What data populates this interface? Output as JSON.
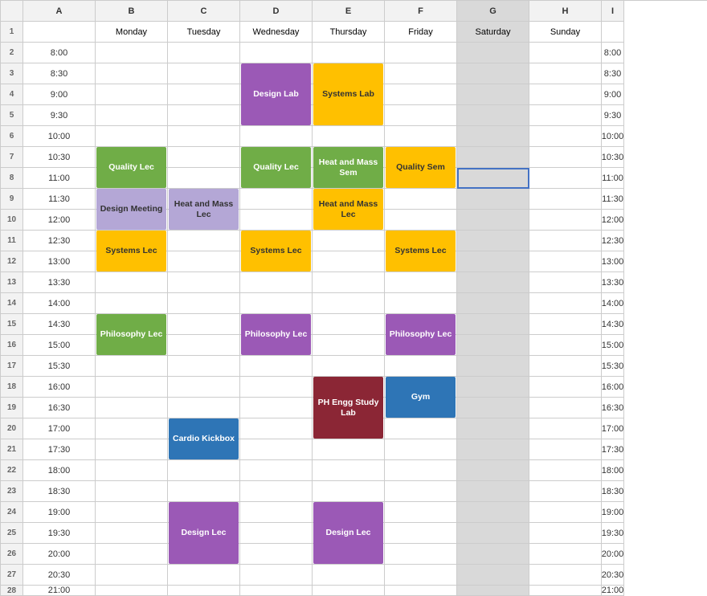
{
  "columns": {
    "headers": [
      "",
      "A",
      "B",
      "C",
      "D",
      "E",
      "F",
      "G",
      "H",
      "I"
    ],
    "day_headers": [
      "",
      "Monday",
      "Tuesday",
      "Wednesday",
      "Thursday",
      "Friday",
      "Saturday",
      "Sunday",
      ""
    ]
  },
  "rows": {
    "numbers": [
      "1",
      "2",
      "3",
      "4",
      "5",
      "6",
      "7",
      "8",
      "9",
      "10",
      "11",
      "12",
      "13",
      "14",
      "15",
      "16",
      "17",
      "18",
      "19",
      "20",
      "21",
      "22",
      "23",
      "24",
      "25",
      "26",
      "27",
      "28"
    ],
    "times": [
      "",
      "8:00",
      "8:30",
      "9:00",
      "9:30",
      "10:00",
      "10:30",
      "11:00",
      "11:30",
      "12:00",
      "12:30",
      "13:00",
      "13:30",
      "14:00",
      "14:30",
      "15:00",
      "15:30",
      "16:00",
      "16:30",
      "17:00",
      "17:30",
      "18:00",
      "18:30",
      "19:00",
      "19:30",
      "20:00",
      "20:30",
      "21:00"
    ]
  },
  "events": [
    {
      "id": "quality-lec-mon",
      "label": "Quality Lec",
      "color": "event-green",
      "col": 2,
      "row_start": 7,
      "row_span": 2
    },
    {
      "id": "design-meeting-mon",
      "label": "Design Meeting",
      "color": "event-lavender",
      "col": 2,
      "row_start": 9,
      "row_span": 2
    },
    {
      "id": "systems-lec-mon",
      "label": "Systems Lec",
      "color": "event-yellow",
      "col": 2,
      "row_start": 11,
      "row_span": 2
    },
    {
      "id": "philosophy-lec-mon",
      "label": "Philosophy Lec",
      "color": "event-green",
      "col": 2,
      "row_start": 15,
      "row_span": 2
    },
    {
      "id": "heat-mass-lec-tue",
      "label": "Heat and Mass Lec",
      "color": "event-lavender",
      "col": 3,
      "row_start": 10,
      "row_span": 2
    },
    {
      "id": "cardio-kickbox-tue",
      "label": "Cardio Kickbox",
      "color": "event-blue",
      "col": 3,
      "row_start": 20,
      "row_span": 2
    },
    {
      "id": "design-lec-tue",
      "label": "Design Lec",
      "color": "event-light-purple",
      "col": 3,
      "row_start": 24,
      "row_span": 3
    },
    {
      "id": "design-lab-wed",
      "label": "Design Lab",
      "color": "event-light-purple",
      "col": 4,
      "row_start": 3,
      "row_span": 3
    },
    {
      "id": "quality-lec-wed",
      "label": "Quality Lec",
      "color": "event-green",
      "col": 4,
      "row_start": 7,
      "row_span": 2
    },
    {
      "id": "systems-lec-wed",
      "label": "Systems Lec",
      "color": "event-yellow",
      "col": 4,
      "row_start": 11,
      "row_span": 2
    },
    {
      "id": "philosophy-lec-wed",
      "label": "Philosophy Lec",
      "color": "event-light-purple",
      "col": 4,
      "row_start": 15,
      "row_span": 2
    },
    {
      "id": "systems-lab-thu",
      "label": "Systems Lab",
      "color": "event-yellow",
      "col": 5,
      "row_start": 3,
      "row_span": 3
    },
    {
      "id": "heat-mass-sem-thu",
      "label": "Heat and Mass Sem",
      "color": "event-green",
      "col": 5,
      "row_start": 7,
      "row_span": 2
    },
    {
      "id": "heat-mass-lec-thu",
      "label": "Heat and Mass Lec",
      "color": "event-yellow",
      "col": 5,
      "row_start": 9,
      "row_span": 2
    },
    {
      "id": "ph-engg-thu",
      "label": "PH Engg Study Lab",
      "color": "event-dark-red",
      "col": 5,
      "row_start": 18,
      "row_span": 3
    },
    {
      "id": "design-lec-thu",
      "label": "Design Lec",
      "color": "event-light-purple",
      "col": 5,
      "row_start": 24,
      "row_span": 3
    },
    {
      "id": "quality-sem-fri",
      "label": "Quality Sem",
      "color": "event-yellow",
      "col": 6,
      "row_start": 7,
      "row_span": 2
    },
    {
      "id": "systems-lec-fri",
      "label": "Systems Lec",
      "color": "event-yellow",
      "col": 6,
      "row_start": 11,
      "row_span": 2
    },
    {
      "id": "philosophy-lec-fri",
      "label": "Philosophy Lec",
      "color": "event-light-purple",
      "col": 6,
      "row_start": 15,
      "row_span": 2
    },
    {
      "id": "gym-fri",
      "label": "Gym",
      "color": "event-blue",
      "col": 6,
      "row_start": 18,
      "row_span": 2
    },
    {
      "id": "selected-g8",
      "label": "",
      "color": "selected-cell",
      "col": 7,
      "row_start": 8,
      "row_span": 1
    }
  ],
  "colors": {
    "header_bg": "#f2f2f2",
    "saturday_bg": "#d9d9d9",
    "border": "#ccc",
    "selected_border": "#4472c4"
  }
}
